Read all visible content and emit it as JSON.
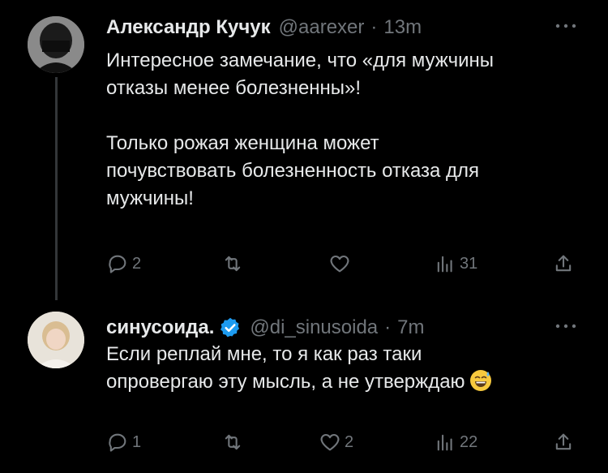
{
  "tweets": [
    {
      "author_name": "Александр Кучук",
      "handle": "@aarexer",
      "separator": "·",
      "time": "13m",
      "text": "Интересное замечание, что «для мужчины\nотказы менее болезненны»!\n\nТолько рожая женщина может\nпочувствовать болезненность отказа для\nмужчины!",
      "replies": "2",
      "retweets": "",
      "likes": "",
      "views": "31",
      "verified": false
    },
    {
      "author_name": "синусоида.",
      "handle": "@di_sinusoida",
      "separator": "·",
      "time": "7m",
      "text": "Если реплай мне, то я как раз таки\nопровергаю эту мысль, а не утверждаю",
      "emoji": "grinning-face-with-sweat-emoji",
      "replies": "1",
      "retweets": "",
      "likes": "2",
      "views": "22",
      "verified": true
    }
  ],
  "colors": {
    "background": "#000000",
    "text": "#e7e9ea",
    "muted": "#71767b",
    "verified": "#1d9bf0",
    "thread_line": "#333639"
  }
}
